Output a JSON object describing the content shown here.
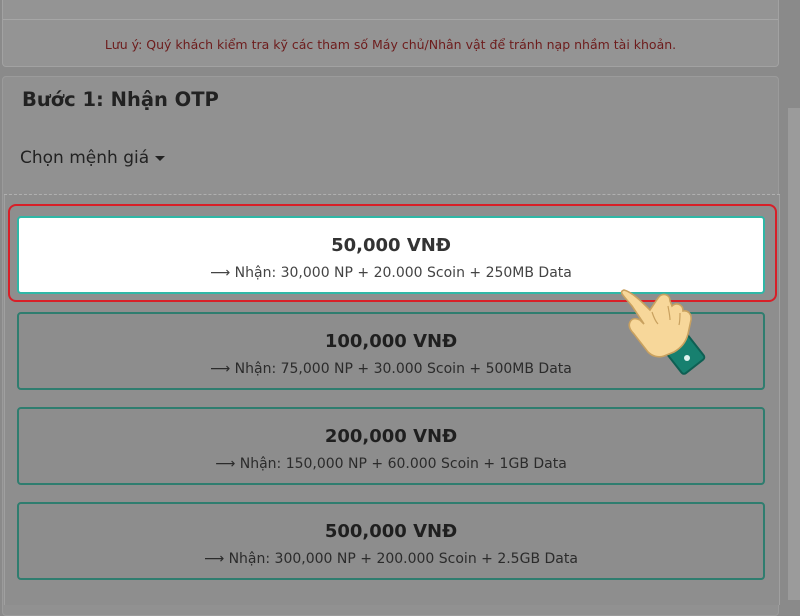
{
  "notice": "Lưu ý: Quý khách kiểm tra kỹ các tham số Máy chủ/Nhân vật để tránh nạp nhầm tài khoản.",
  "step": {
    "title": "Bước 1: Nhận OTP",
    "denomination_label": "Chọn mệnh giá"
  },
  "options": [
    {
      "price": "50,000 VNĐ",
      "receive": "⟶ Nhận: 30,000 NP + 20.000 Scoin + 250MB Data",
      "selected": true
    },
    {
      "price": "100,000 VNĐ",
      "receive": "⟶ Nhận: 75,000 NP + 30.000 Scoin + 500MB Data",
      "selected": false
    },
    {
      "price": "200,000 VNĐ",
      "receive": "⟶ Nhận: 150,000 NP + 60.000 Scoin + 1GB Data",
      "selected": false
    },
    {
      "price": "500,000 VNĐ",
      "receive": "⟶ Nhận: 300,000 NP + 200.000 Scoin + 2.5GB Data",
      "selected": false
    }
  ],
  "colors": {
    "overlay": "#8a8a8a",
    "notice_text": "#6d1c1c",
    "card_border": "#2f7d6f",
    "selected_border": "#2fb7a6",
    "highlight": "#d81f28",
    "hand_skin": "#f7d79a",
    "cuff": "#17806f"
  },
  "icons": {
    "pointer": "pointing-hand-icon",
    "dropdown": "caret-down-icon"
  }
}
